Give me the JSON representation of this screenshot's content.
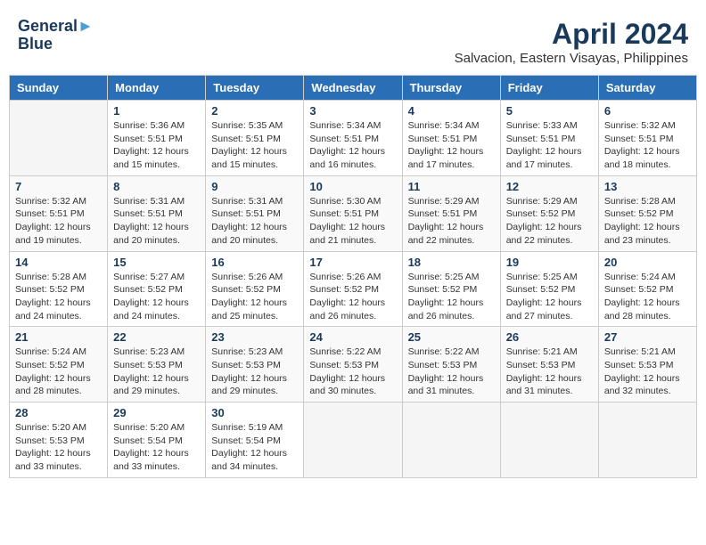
{
  "header": {
    "logo_line1": "General",
    "logo_line2": "Blue",
    "title": "April 2024",
    "subtitle": "Salvacion, Eastern Visayas, Philippines"
  },
  "days_of_week": [
    "Sunday",
    "Monday",
    "Tuesday",
    "Wednesday",
    "Thursday",
    "Friday",
    "Saturday"
  ],
  "weeks": [
    [
      {
        "day": "",
        "info": ""
      },
      {
        "day": "1",
        "info": "Sunrise: 5:36 AM\nSunset: 5:51 PM\nDaylight: 12 hours\nand 15 minutes."
      },
      {
        "day": "2",
        "info": "Sunrise: 5:35 AM\nSunset: 5:51 PM\nDaylight: 12 hours\nand 15 minutes."
      },
      {
        "day": "3",
        "info": "Sunrise: 5:34 AM\nSunset: 5:51 PM\nDaylight: 12 hours\nand 16 minutes."
      },
      {
        "day": "4",
        "info": "Sunrise: 5:34 AM\nSunset: 5:51 PM\nDaylight: 12 hours\nand 17 minutes."
      },
      {
        "day": "5",
        "info": "Sunrise: 5:33 AM\nSunset: 5:51 PM\nDaylight: 12 hours\nand 17 minutes."
      },
      {
        "day": "6",
        "info": "Sunrise: 5:32 AM\nSunset: 5:51 PM\nDaylight: 12 hours\nand 18 minutes."
      }
    ],
    [
      {
        "day": "7",
        "info": "Sunrise: 5:32 AM\nSunset: 5:51 PM\nDaylight: 12 hours\nand 19 minutes."
      },
      {
        "day": "8",
        "info": "Sunrise: 5:31 AM\nSunset: 5:51 PM\nDaylight: 12 hours\nand 20 minutes."
      },
      {
        "day": "9",
        "info": "Sunrise: 5:31 AM\nSunset: 5:51 PM\nDaylight: 12 hours\nand 20 minutes."
      },
      {
        "day": "10",
        "info": "Sunrise: 5:30 AM\nSunset: 5:51 PM\nDaylight: 12 hours\nand 21 minutes."
      },
      {
        "day": "11",
        "info": "Sunrise: 5:29 AM\nSunset: 5:51 PM\nDaylight: 12 hours\nand 22 minutes."
      },
      {
        "day": "12",
        "info": "Sunrise: 5:29 AM\nSunset: 5:52 PM\nDaylight: 12 hours\nand 22 minutes."
      },
      {
        "day": "13",
        "info": "Sunrise: 5:28 AM\nSunset: 5:52 PM\nDaylight: 12 hours\nand 23 minutes."
      }
    ],
    [
      {
        "day": "14",
        "info": "Sunrise: 5:28 AM\nSunset: 5:52 PM\nDaylight: 12 hours\nand 24 minutes."
      },
      {
        "day": "15",
        "info": "Sunrise: 5:27 AM\nSunset: 5:52 PM\nDaylight: 12 hours\nand 24 minutes."
      },
      {
        "day": "16",
        "info": "Sunrise: 5:26 AM\nSunset: 5:52 PM\nDaylight: 12 hours\nand 25 minutes."
      },
      {
        "day": "17",
        "info": "Sunrise: 5:26 AM\nSunset: 5:52 PM\nDaylight: 12 hours\nand 26 minutes."
      },
      {
        "day": "18",
        "info": "Sunrise: 5:25 AM\nSunset: 5:52 PM\nDaylight: 12 hours\nand 26 minutes."
      },
      {
        "day": "19",
        "info": "Sunrise: 5:25 AM\nSunset: 5:52 PM\nDaylight: 12 hours\nand 27 minutes."
      },
      {
        "day": "20",
        "info": "Sunrise: 5:24 AM\nSunset: 5:52 PM\nDaylight: 12 hours\nand 28 minutes."
      }
    ],
    [
      {
        "day": "21",
        "info": "Sunrise: 5:24 AM\nSunset: 5:52 PM\nDaylight: 12 hours\nand 28 minutes."
      },
      {
        "day": "22",
        "info": "Sunrise: 5:23 AM\nSunset: 5:53 PM\nDaylight: 12 hours\nand 29 minutes."
      },
      {
        "day": "23",
        "info": "Sunrise: 5:23 AM\nSunset: 5:53 PM\nDaylight: 12 hours\nand 29 minutes."
      },
      {
        "day": "24",
        "info": "Sunrise: 5:22 AM\nSunset: 5:53 PM\nDaylight: 12 hours\nand 30 minutes."
      },
      {
        "day": "25",
        "info": "Sunrise: 5:22 AM\nSunset: 5:53 PM\nDaylight: 12 hours\nand 31 minutes."
      },
      {
        "day": "26",
        "info": "Sunrise: 5:21 AM\nSunset: 5:53 PM\nDaylight: 12 hours\nand 31 minutes."
      },
      {
        "day": "27",
        "info": "Sunrise: 5:21 AM\nSunset: 5:53 PM\nDaylight: 12 hours\nand 32 minutes."
      }
    ],
    [
      {
        "day": "28",
        "info": "Sunrise: 5:20 AM\nSunset: 5:53 PM\nDaylight: 12 hours\nand 33 minutes."
      },
      {
        "day": "29",
        "info": "Sunrise: 5:20 AM\nSunset: 5:54 PM\nDaylight: 12 hours\nand 33 minutes."
      },
      {
        "day": "30",
        "info": "Sunrise: 5:19 AM\nSunset: 5:54 PM\nDaylight: 12 hours\nand 34 minutes."
      },
      {
        "day": "",
        "info": ""
      },
      {
        "day": "",
        "info": ""
      },
      {
        "day": "",
        "info": ""
      },
      {
        "day": "",
        "info": ""
      }
    ]
  ]
}
